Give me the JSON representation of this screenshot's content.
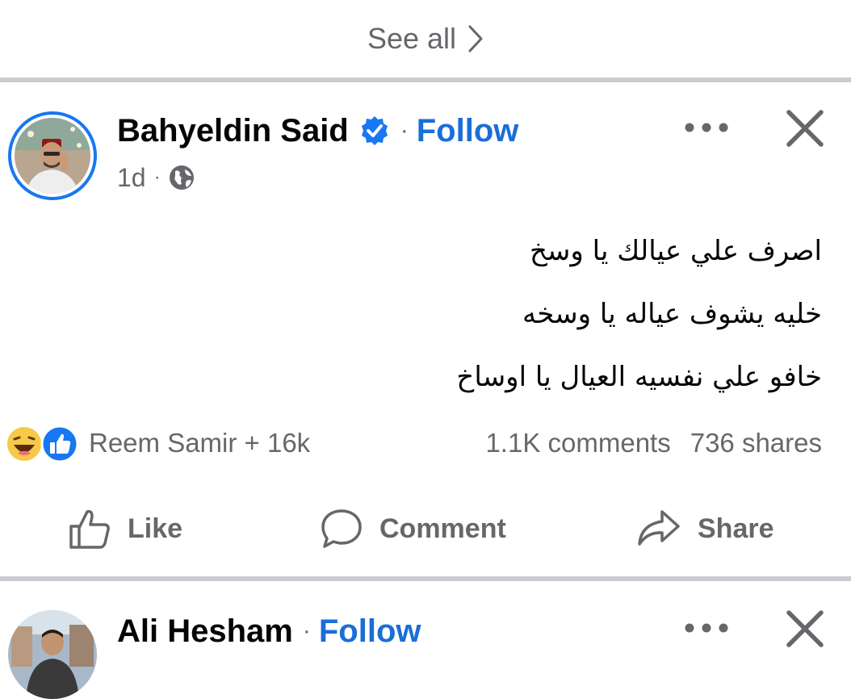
{
  "see_all": {
    "label": "See all",
    "icon": "chevron-right-icon"
  },
  "post": {
    "author": "Bahyeldin Said",
    "verified_icon": "verified-badge-icon",
    "separator": "·",
    "follow_label": "Follow",
    "time": "1d",
    "meta_separator": "·",
    "audience_icon": "globe-icon",
    "more_icon": "more-options-icon",
    "close_icon": "close-icon",
    "lines": [
      "اصرف علي عيالك يا وسخ",
      "خليه يشوف عياله يا وسخه",
      "خافو علي نفسيه العيال يا اوساخ"
    ],
    "reactions": {
      "icons": [
        "haha-reaction-icon",
        "like-reaction-icon"
      ],
      "text": "Reem Samir + 16k"
    },
    "comments": "1.1K comments",
    "shares": "736 shares",
    "actions": {
      "like": "Like",
      "comment": "Comment",
      "share": "Share"
    }
  },
  "next_post": {
    "author": "Ali Hesham",
    "separator": "·",
    "follow_label": "Follow"
  },
  "colors": {
    "brand_blue": "#1877f2",
    "follow_blue": "#1a6ed8",
    "secondary_text": "#65676b",
    "divider": "#c9ccd1"
  }
}
